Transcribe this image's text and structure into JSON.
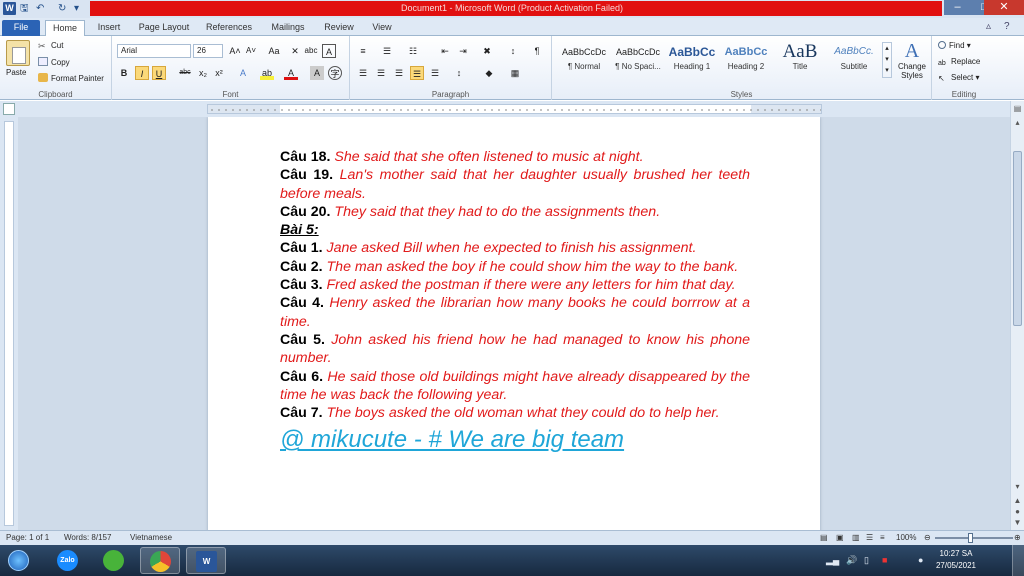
{
  "window": {
    "title": "Document1  -  Microsoft Word (Product Activation Failed)",
    "word_icon": "W",
    "accent": "#e11010"
  },
  "tabs": [
    "File",
    "Home",
    "Insert",
    "Page Layout",
    "References",
    "Mailings",
    "Review",
    "View"
  ],
  "ribbon": {
    "clipboard": {
      "label": "Clipboard",
      "paste": "Paste",
      "cut": "Cut",
      "copy": "Copy",
      "format_painter": "Format Painter"
    },
    "font": {
      "label": "Font",
      "font_name": "Arial",
      "font_size": "26",
      "bold": "B",
      "italic": "I",
      "underline": "U",
      "strike": "abc",
      "subscript": "x₂",
      "superscript": "x²"
    },
    "paragraph": {
      "label": "Paragraph"
    },
    "styles": {
      "label": "Styles",
      "items": [
        {
          "sample": "AaBbCcDc",
          "name": "¶ Normal"
        },
        {
          "sample": "AaBbCcDc",
          "name": "¶ No Spaci..."
        },
        {
          "sample": "AaBbCc",
          "name": "Heading 1"
        },
        {
          "sample": "AaBbCc",
          "name": "Heading 2"
        },
        {
          "sample": "AaB",
          "name": "Title"
        },
        {
          "sample": "AaBbCc.",
          "name": "Subtitle"
        }
      ],
      "change_styles": "Change Styles"
    },
    "editing": {
      "label": "Editing",
      "find": "Find",
      "replace": "Replace",
      "select": "Select"
    }
  },
  "document": {
    "lines": [
      {
        "num": "Câu 18.",
        "text": " She said that she often listened to music at night."
      },
      {
        "num": "Câu 19.",
        "text": " Lan's mother said that her daughter usually brushed her teeth before meals."
      },
      {
        "num": "Câu 20.",
        "text": " They said that they had to do the assignments then."
      },
      {
        "heading": "Bài 5:"
      },
      {
        "num": "Câu 1.",
        "text": " Jane asked Bill when he expected to finish his assignment."
      },
      {
        "num": "Câu 2.",
        "text": " The man asked the boy if he could show him the way to the bank."
      },
      {
        "num": "Câu 3.",
        "text": " Fred asked the postman if there were any letters for him that day."
      },
      {
        "num": "Câu 4.",
        "text": " Henry asked the librarian how many books he could borrrow at a time."
      },
      {
        "num": "Câu 5.",
        "text": " John asked his friend how he had managed to know his phone number."
      },
      {
        "num": "Câu 6.",
        "text": " He said those old buildings might have already disappeared by the time he was back the following year."
      },
      {
        "num": "Câu 7.",
        "text": " The boys asked the old woman what they could do to help her."
      }
    ],
    "signature": "@ mikucute - # We are big team"
  },
  "status": {
    "page": "Page: 1 of 1",
    "words": "Words: 8/157",
    "language": "Vietnamese",
    "zoom": "100%"
  },
  "taskbar": {
    "apps": [
      {
        "name": "zalo",
        "label": "Zalo",
        "color": "#1a8cff"
      },
      {
        "name": "app-green",
        "label": "",
        "color": "#48b33a"
      },
      {
        "name": "chrome",
        "label": "",
        "color": "#e0463a"
      },
      {
        "name": "word",
        "label": "W",
        "color": "#2a5699"
      }
    ],
    "time": "10:27 SA",
    "date": "27/05/2021"
  }
}
